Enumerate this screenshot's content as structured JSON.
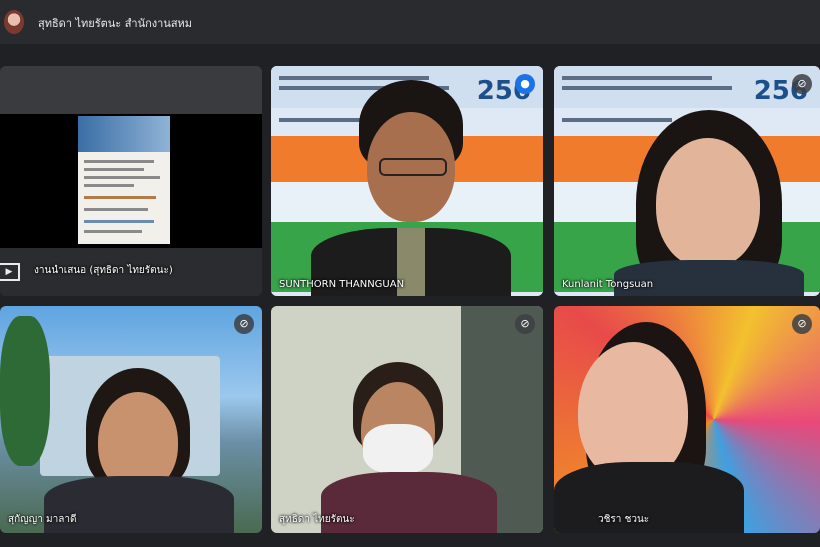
{
  "header": {
    "title": "สุทธิดา ไทยรัตนะ สำนักงานสหม"
  },
  "tiles": [
    {
      "name": "งานนำเสนอ (สุทธิดา ไทยรัตนะ)",
      "type": "presentation"
    },
    {
      "name": "SUNTHORN THANNGUAN",
      "speaking": true
    },
    {
      "name": "Kunlanit Tongsuan",
      "speaking": false
    },
    {
      "name": "สุกัญญา มาลาดี",
      "speaking": false
    },
    {
      "name": "สุทธิดา ไทยรัตนะ",
      "speaking": false
    },
    {
      "name": "วชิรา ชวนะ",
      "speaking": false
    }
  ],
  "slide": {
    "year": "256"
  },
  "icons": {
    "mic_on": "mic-active-icon",
    "mic_off": "mic-muted-icon"
  },
  "colors": {
    "accent": "#8ab4f8",
    "background": "#202124"
  }
}
